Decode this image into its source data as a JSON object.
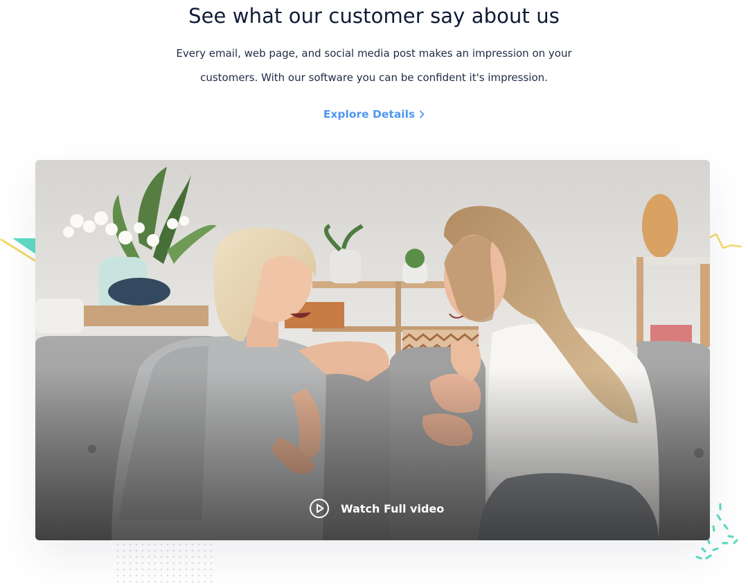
{
  "section": {
    "title": "See what our customer say about us",
    "description": "Every email, web page, and social media post makes an impression on your customers. With our software you can be confident it's impression.",
    "explore_label": "Explore Details"
  },
  "video": {
    "watch_label": "Watch Full video"
  },
  "icons": {
    "explore": "chevron-right-icon",
    "watch": "play-circle-icon"
  },
  "colors": {
    "heading": "#0f1b35",
    "body": "#1f2a44",
    "accent": "#4e97f2",
    "teal": "#5fdcc6",
    "yellow": "#f5d765"
  }
}
